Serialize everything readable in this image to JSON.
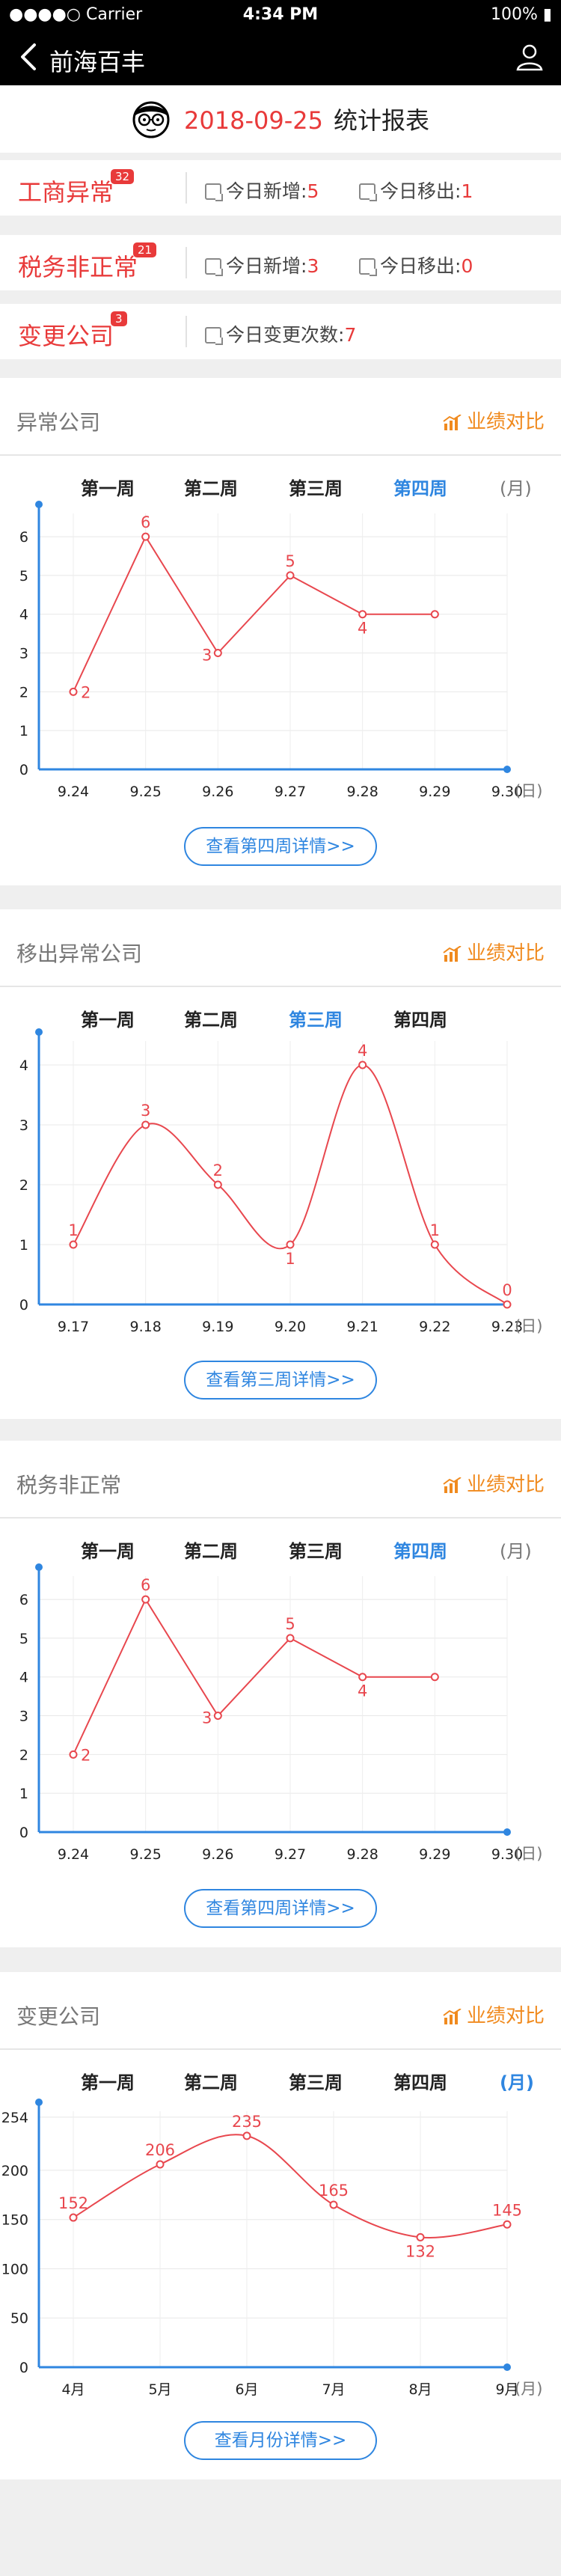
{
  "status_bar": {
    "carrier": "●●●●○ Carrier",
    "time": "4:34 PM",
    "battery": "100%"
  },
  "nav": {
    "title": "前海百丰"
  },
  "header": {
    "date": "2018-09-25",
    "label": "统计报表"
  },
  "summary": [
    {
      "name": "工商异常",
      "badge": "32",
      "a_label": "今日新增:",
      "a_value": "5",
      "b_label": "今日移出:",
      "b_value": "1"
    },
    {
      "name": "税务非正常",
      "badge": "21",
      "a_label": "今日新增:",
      "a_value": "3",
      "b_label": "今日移出:",
      "b_value": "0"
    },
    {
      "name": "变更公司",
      "badge": "3",
      "a_label": "今日变更次数:",
      "a_value": "7"
    }
  ],
  "compare_label": "业绩对比",
  "sections": [
    {
      "title": "异常公司",
      "tabs": [
        "第一周",
        "第二周",
        "第三周",
        "第四周",
        "(月)"
      ],
      "active": 3,
      "button": "查看第四周详情>>"
    },
    {
      "title": "移出异常公司",
      "tabs": [
        "第一周",
        "第二周",
        "第三周",
        "第四周"
      ],
      "active": 2,
      "button": "查看第三周详情>>"
    },
    {
      "title": "税务非正常",
      "tabs": [
        "第一周",
        "第二周",
        "第三周",
        "第四周",
        "(月)"
      ],
      "active": 3,
      "button": "查看第四周详情>>"
    },
    {
      "title": "变更公司",
      "tabs": [
        "第一周",
        "第二周",
        "第三周",
        "第四周",
        "(月)"
      ],
      "active": 4,
      "button": "查看月份详情>>"
    }
  ],
  "chart_data": [
    {
      "type": "line",
      "smooth": false,
      "categories": [
        "9.24",
        "9.25",
        "9.26",
        "9.27",
        "9.28",
        "9.29",
        "9.30"
      ],
      "x_unit": "(日)",
      "yticks": [
        0,
        1,
        2,
        3,
        4,
        5,
        6
      ],
      "ylim": [
        0,
        6.6
      ],
      "points": [
        {
          "x": "9.24",
          "y": 2
        },
        {
          "x": "9.25",
          "y": 6
        },
        {
          "x": "9.26",
          "y": 3
        },
        {
          "x": "9.27",
          "y": 5
        },
        {
          "x": "9.28",
          "y": 4
        },
        {
          "x": "9.29",
          "y": 4
        }
      ],
      "labels": [
        {
          "i": 0,
          "text": "2"
        },
        {
          "i": 1,
          "text": "6"
        },
        {
          "i": 2,
          "text": "3"
        },
        {
          "i": 3,
          "text": "5"
        },
        {
          "i": 4,
          "text": "4"
        }
      ],
      "color": "#e8474e"
    },
    {
      "type": "line",
      "smooth": true,
      "categories": [
        "9.17",
        "9.18",
        "9.19",
        "9.20",
        "9.21",
        "9.22",
        "9.23"
      ],
      "x_unit": "(日)",
      "yticks": [
        0,
        1,
        2,
        3,
        4
      ],
      "ylim": [
        0,
        4.4
      ],
      "points": [
        {
          "x": "9.17",
          "y": 1
        },
        {
          "x": "9.18",
          "y": 3
        },
        {
          "x": "9.19",
          "y": 2
        },
        {
          "x": "9.20",
          "y": 1
        },
        {
          "x": "9.21",
          "y": 4
        },
        {
          "x": "9.22",
          "y": 1
        },
        {
          "x": "9.23",
          "y": 0
        }
      ],
      "labels": [
        {
          "i": 0,
          "text": "1"
        },
        {
          "i": 1,
          "text": "3"
        },
        {
          "i": 2,
          "text": "2"
        },
        {
          "i": 3,
          "text": "1"
        },
        {
          "i": 4,
          "text": "4"
        },
        {
          "i": 5,
          "text": "1"
        },
        {
          "i": 6,
          "text": "0"
        }
      ],
      "color": "#e8474e"
    },
    {
      "type": "line",
      "smooth": false,
      "categories": [
        "9.24",
        "9.25",
        "9.26",
        "9.27",
        "9.28",
        "9.29",
        "9.30"
      ],
      "x_unit": "(日)",
      "yticks": [
        0,
        1,
        2,
        3,
        4,
        5,
        6
      ],
      "ylim": [
        0,
        6.6
      ],
      "points": [
        {
          "x": "9.24",
          "y": 2
        },
        {
          "x": "9.25",
          "y": 6
        },
        {
          "x": "9.26",
          "y": 3
        },
        {
          "x": "9.27",
          "y": 5
        },
        {
          "x": "9.28",
          "y": 4
        },
        {
          "x": "9.29",
          "y": 4
        }
      ],
      "labels": [
        {
          "i": 0,
          "text": "2"
        },
        {
          "i": 1,
          "text": "6"
        },
        {
          "i": 2,
          "text": "3"
        },
        {
          "i": 3,
          "text": "5"
        },
        {
          "i": 4,
          "text": "4"
        }
      ],
      "color": "#e8474e"
    },
    {
      "type": "line",
      "smooth": true,
      "categories": [
        "4月",
        "5月",
        "6月",
        "7月",
        "8月",
        "9月"
      ],
      "x_unit": "(月)",
      "yticks": [
        0,
        50,
        100,
        150,
        200,
        254
      ],
      "ylim": [
        0,
        260
      ],
      "points": [
        {
          "x": "4月",
          "y": 152
        },
        {
          "x": "5月",
          "y": 206
        },
        {
          "x": "6月",
          "y": 235
        },
        {
          "x": "7月",
          "y": 165
        },
        {
          "x": "8月",
          "y": 132
        },
        {
          "x": "9月",
          "y": 145
        }
      ],
      "labels": [
        {
          "i": 0,
          "text": "152"
        },
        {
          "i": 1,
          "text": "206"
        },
        {
          "i": 2,
          "text": "235"
        },
        {
          "i": 3,
          "text": "165"
        },
        {
          "i": 4,
          "text": "132"
        },
        {
          "i": 5,
          "text": "145"
        }
      ],
      "color": "#e8474e"
    }
  ]
}
